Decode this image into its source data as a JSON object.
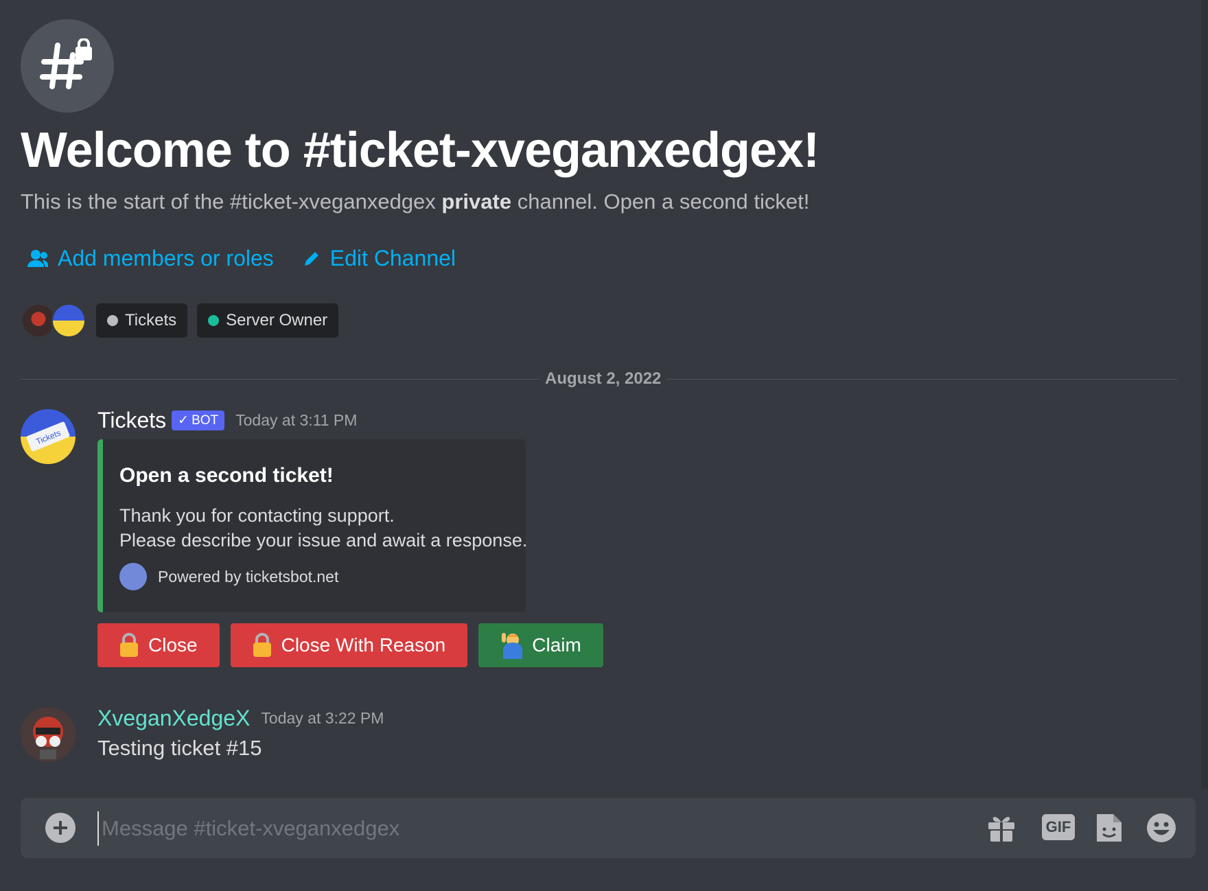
{
  "channel": {
    "welcome_title": "Welcome to #ticket-xveganxedgex!",
    "subtitle_pre": "This is the start of the #ticket-xveganxedgex ",
    "subtitle_bold": "private",
    "subtitle_post": " channel. Open a second ticket!",
    "add_members_label": "Add members or roles",
    "edit_channel_label": "Edit Channel",
    "roles": [
      {
        "name": "Tickets",
        "color": "#b9bbbe"
      },
      {
        "name": "Server Owner",
        "color": "#1abc9c"
      }
    ]
  },
  "date_divider": "August 2, 2022",
  "messages": [
    {
      "author": "Tickets",
      "bot_tag": "BOT",
      "timestamp": "Today at 3:11 PM",
      "embed": {
        "title": "Open a second ticket!",
        "line1": "Thank you for contacting support.",
        "line2": "Please describe your issue and await a response.",
        "footer": "Powered by ticketsbot.net",
        "accent_color": "#3ba55d"
      },
      "buttons": [
        {
          "label": "Close",
          "icon": "lock-icon",
          "style": "danger"
        },
        {
          "label": "Close With Reason",
          "icon": "lock-icon",
          "style": "danger"
        },
        {
          "label": "Claim",
          "icon": "person-raising-hand-icon",
          "style": "success"
        }
      ]
    },
    {
      "author": "XveganXedgeX",
      "author_color": "#62e3d0",
      "timestamp": "Today at 3:22 PM",
      "text": "Testing ticket #15"
    }
  ],
  "composer": {
    "placeholder": "Message #ticket-xveganxedgex",
    "gif_label": "GIF"
  }
}
